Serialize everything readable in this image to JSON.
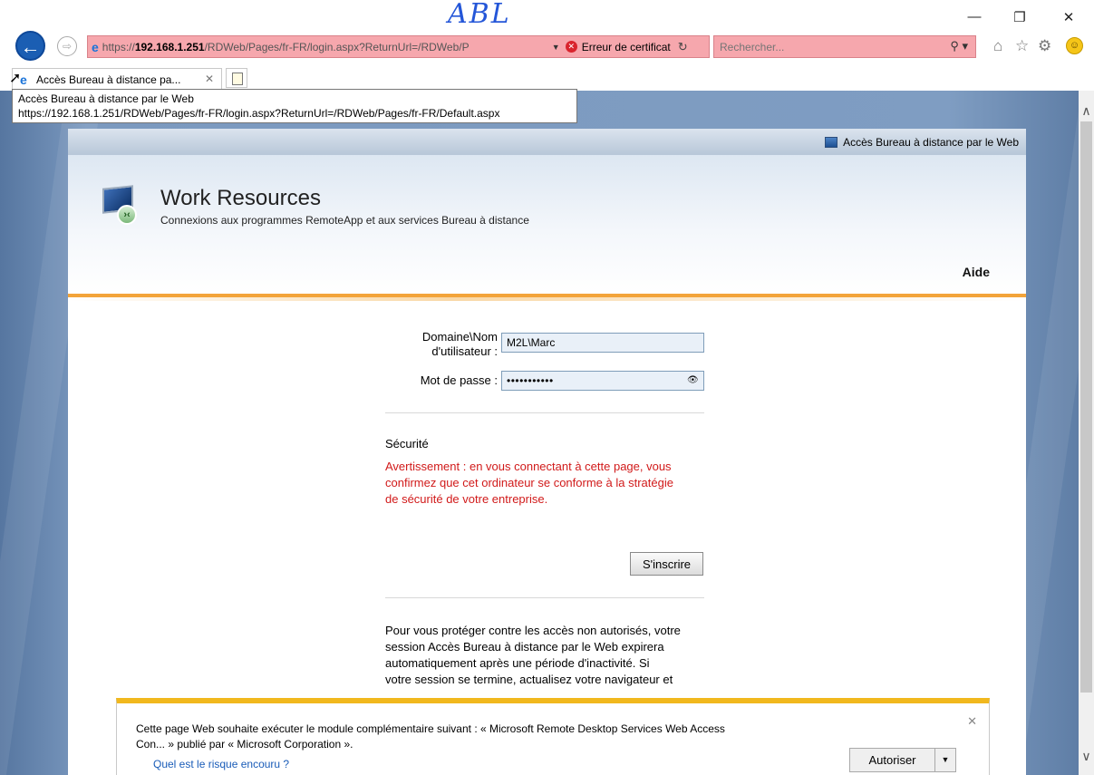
{
  "handwriting": "ABL",
  "address_bar": {
    "url_prefix": "https://",
    "url_host": "192.168.1.251",
    "url_path": "/RDWeb/Pages/fr-FR/login.aspx?ReturnUrl=/RDWeb/P",
    "cert_error": "Erreur de certificat"
  },
  "search": {
    "placeholder": "Rechercher..."
  },
  "tab": {
    "label": "Accès Bureau à distance pa...",
    "tooltip_title": "Accès Bureau à distance par le Web",
    "tooltip_url": "https://192.168.1.251/RDWeb/Pages/fr-FR/login.aspx?ReturnUrl=/RDWeb/Pages/fr-FR/Default.aspx"
  },
  "rd": {
    "topbar_label": "Accès Bureau à distance par le Web",
    "title": "Work Resources",
    "subtitle": "Connexions aux programmes RemoteApp et aux services Bureau à distance",
    "help": "Aide",
    "login": {
      "username_label_1": "Domaine\\Nom",
      "username_label_2": "d'utilisateur :",
      "username_value": "M2L\\Marc",
      "password_label": "Mot de passe :",
      "password_value": "•••••••••••",
      "security_title": "Sécurité",
      "warning_1": "Avertissement : en vous connectant à cette page, vous",
      "warning_2": "confirmez que cet ordinateur se conforme à la stratégie",
      "warning_3": "de sécurité de votre entreprise.",
      "signin_label": "S'inscrire",
      "info_1": "Pour vous protéger contre les accès non autorisés, votre",
      "info_2": "session Accès Bureau à distance par le Web expirera",
      "info_3": "automatiquement après une période d'inactivité. Si",
      "info_4": "votre session se termine, actualisez votre navigateur et"
    }
  },
  "notification": {
    "message_1": "Cette page Web souhaite exécuter le module complémentaire suivant : « Microsoft Remote Desktop Services Web Access",
    "message_2": "Con... » publié par « Microsoft Corporation ».",
    "link": "Quel est le risque encouru ?",
    "allow_label": "Autoriser"
  },
  "colors": {
    "address_error_bg": "#f6a7ad",
    "accent_orange": "#f3a43a",
    "warning_red": "#d11a1a",
    "notification_yellow": "#f1b81e",
    "ie_blue": "#1b5eb3"
  }
}
